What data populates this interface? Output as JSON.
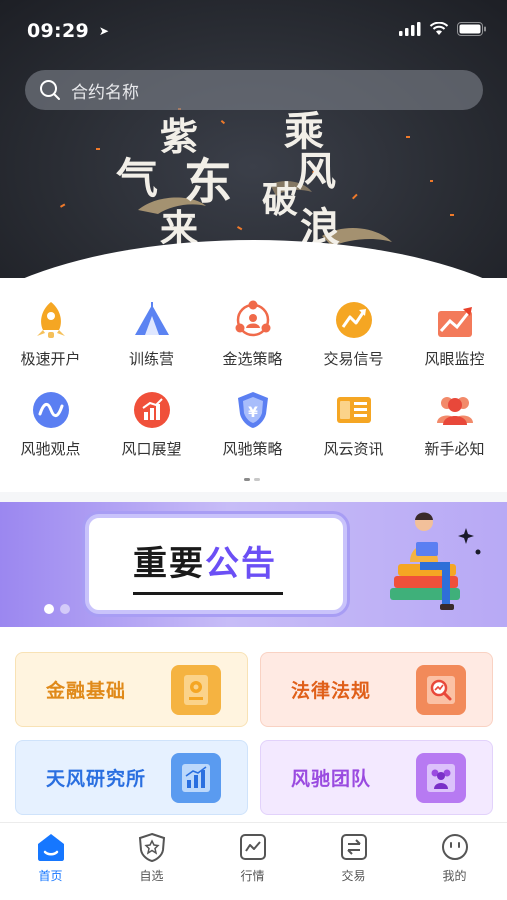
{
  "status_bar": {
    "time": "09:29"
  },
  "search": {
    "placeholder": "合约名称"
  },
  "hero": {
    "poem_left": [
      "紫",
      "气",
      "东",
      "来"
    ],
    "poem_right": [
      "乘",
      "风",
      "破",
      "浪"
    ]
  },
  "grid": [
    {
      "label": "极速开户",
      "icon": "rocket-icon",
      "color": "#f5a623"
    },
    {
      "label": "训练营",
      "icon": "tent-icon",
      "color": "#4a74f0"
    },
    {
      "label": "金选策略",
      "icon": "network-icon",
      "color": "#f06a4a"
    },
    {
      "label": "交易信号",
      "icon": "signal-icon",
      "color": "#f5a623"
    },
    {
      "label": "风眼监控",
      "icon": "trend-up-icon",
      "color": "#f0503a"
    },
    {
      "label": "风驰观点",
      "icon": "wave-icon",
      "color": "#4a74f0"
    },
    {
      "label": "风口展望",
      "icon": "bar-chart-icon",
      "color": "#f0503a"
    },
    {
      "label": "风驰策略",
      "icon": "shield-yen-icon",
      "color": "#4a74f0"
    },
    {
      "label": "风云资讯",
      "icon": "news-icon",
      "color": "#f5a623"
    },
    {
      "label": "新手必知",
      "icon": "users-icon",
      "color": "#f0503a"
    }
  ],
  "banner": {
    "title_dark": "重要",
    "title_accent": "公告"
  },
  "cards": [
    {
      "label": "金融基础",
      "icon": "gear-badge-icon",
      "text_color": "#e08a1a",
      "bg": "#fff4df",
      "border": "#f8e2b5",
      "icon_bg": "#f5b341"
    },
    {
      "label": "法律法规",
      "icon": "magnifier-chart-icon",
      "text_color": "#e0601a",
      "bg": "#ffeae3",
      "border": "#f9d2c3",
      "icon_bg": "#f28a5a"
    },
    {
      "label": "天风研究所",
      "icon": "bar-chart-icon",
      "text_color": "#2a6fe0",
      "bg": "#e6f1ff",
      "border": "#cfe3fb",
      "icon_bg": "#5a9bf0"
    },
    {
      "label": "风驰团队",
      "icon": "team-icon",
      "text_color": "#9a4be0",
      "bg": "#f3e9ff",
      "border": "#e2d2fb",
      "icon_bg": "#b77af2"
    }
  ],
  "tabs": [
    {
      "label": "首页",
      "icon": "home-icon",
      "active": true
    },
    {
      "label": "自选",
      "icon": "star-badge-icon",
      "active": false
    },
    {
      "label": "行情",
      "icon": "chart-icon",
      "active": false
    },
    {
      "label": "交易",
      "icon": "exchange-icon",
      "active": false
    },
    {
      "label": "我的",
      "icon": "profile-icon",
      "active": false
    }
  ],
  "colors": {
    "accent": "#1677ff",
    "hero_bg": "#2a2d34"
  }
}
